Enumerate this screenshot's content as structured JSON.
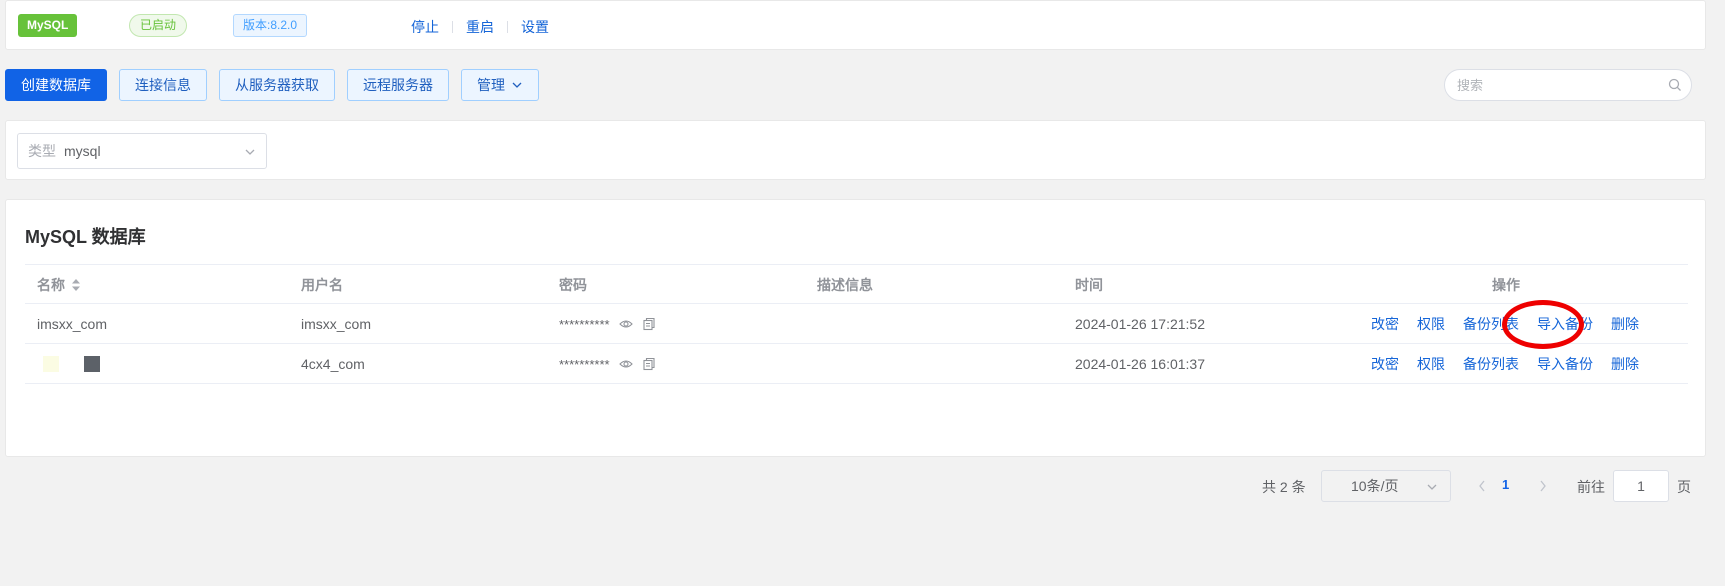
{
  "status_bar": {
    "service_badge": "MySQL",
    "status_badge": "已启动",
    "version_badge": "版本:8.2.0",
    "actions": [
      "停止",
      "重启",
      "设置"
    ]
  },
  "toolbar": {
    "create_db": "创建数据库",
    "connection_info": "连接信息",
    "fetch_from_server": "从服务器获取",
    "remote_server": "远程服务器",
    "manage": "管理"
  },
  "search": {
    "placeholder": "搜索"
  },
  "filter": {
    "type_label": "类型",
    "type_value": "mysql"
  },
  "db_table": {
    "title": "MySQL 数据库",
    "headers": [
      "名称",
      "用户名",
      "密码",
      "描述信息",
      "时间",
      "操作"
    ],
    "rows": [
      {
        "name": "imsxx_com",
        "username": "imsxx_com",
        "password": "**********",
        "description": "",
        "time": "2024-01-26 17:21:52",
        "ops": [
          "改密",
          "权限",
          "备份列表",
          "导入备份",
          "删除"
        ]
      },
      {
        "name": "",
        "username": "4cx4_com",
        "password": "**********",
        "description": "",
        "time": "2024-01-26 16:01:37",
        "ops": [
          "改密",
          "权限",
          "备份列表",
          "导入备份",
          "删除"
        ]
      }
    ]
  },
  "pagination": {
    "total": "共 2 条",
    "page_size": "10条/页",
    "current_page": "1",
    "goto_label": "前往",
    "goto_value": "1",
    "page_unit": "页"
  },
  "colors": {
    "primary": "#1163e6",
    "link": "#1565d8",
    "success": "#67c23a",
    "highlight": "#ee0000"
  }
}
